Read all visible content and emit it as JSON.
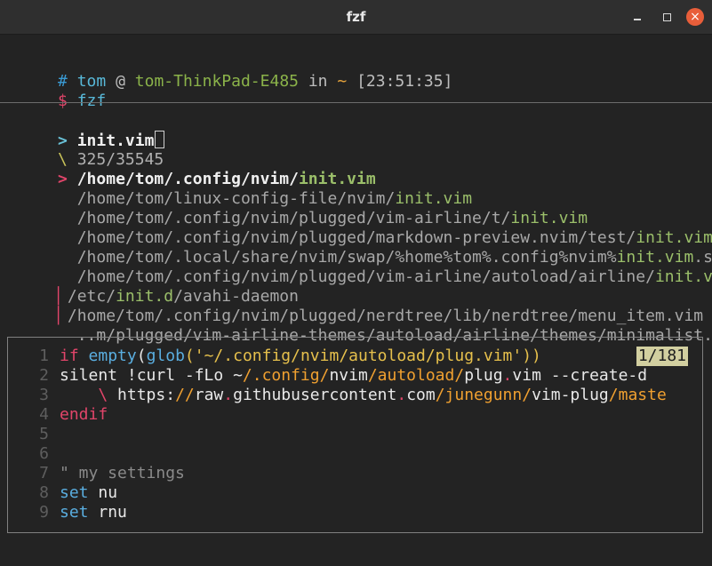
{
  "window": {
    "title": "fzf"
  },
  "prompt": {
    "hash": "#",
    "user": "tom",
    "at": "@",
    "host": "tom-ThinkPad-E485",
    "in": "in",
    "dir": "~",
    "time": "[23:51:35]",
    "dollar": "$",
    "command": "fzf"
  },
  "fzf": {
    "prompt_char": ">",
    "query": "init.vim",
    "info_char": "\\",
    "count": "325/35545",
    "pointer": ">",
    "results": [
      {
        "pre": "/home/tom/.config/nvim/",
        "match": "init.vim",
        "post": ""
      },
      {
        "pre": "/home/tom/linux-config-file/nvim/",
        "match": "init.vim",
        "post": ""
      },
      {
        "pre": "/home/tom/.config/nvim/plugged/vim-airline/t/",
        "match": "init.vim",
        "post": ""
      },
      {
        "pre": "/home/tom/.config/nvim/plugged/markdown-preview.nvim/test/",
        "match": "init.vim",
        "post": ""
      },
      {
        "pre": "/home/tom/.local/share/nvim/swap/%home%tom%.config%nvim%",
        "match": "init.vim",
        "post": ".swp"
      },
      {
        "pre": "/home/tom/.config/nvim/plugged/vim-airline/autoload/airline/",
        "match": "init.vim",
        "post": ""
      },
      {
        "pre": "/etc/",
        "match": "init.d",
        "post": "/avahi-daemon"
      },
      {
        "pre": "/home/tom/.config/nvim/plugged/nerdtree/lib/nerdtree/menu_item.vim",
        "match": "",
        "post": ""
      },
      {
        "pre": "..m/plugged/vim-airline-themes/autoload/airline/themes/minimalist.vim",
        "match": "",
        "post": ""
      }
    ]
  },
  "preview": {
    "position": "1/181",
    "lines": [
      {
        "n": "1"
      },
      {
        "n": "2"
      },
      {
        "n": "3"
      },
      {
        "n": "4"
      },
      {
        "n": "5"
      },
      {
        "n": "6"
      },
      {
        "n": "7"
      },
      {
        "n": "8"
      },
      {
        "n": "9"
      }
    ],
    "code": {
      "l1_if": "if",
      "l1_empty": "empty",
      "l1_open": "(",
      "l1_glob": "glob",
      "l1_str": "('~/.config/nvim/autoload/plug.vim'))",
      "l2_a": "silent !curl -fLo ~",
      "l2_b": "/.config/",
      "l2_c": "nvim",
      "l2_d": "/autoload/",
      "l2_e": "plug",
      "l2_f": ".",
      "l2_g": "vim --create-d",
      "l3_a": "\\",
      "l3_b": " https:",
      "l3_c": "//",
      "l3_d": "raw",
      "l3_e": ".",
      "l3_f": "githubusercontent",
      "l3_g": ".",
      "l3_h": "com",
      "l3_i": "/junegunn/",
      "l3_j": "vim-plug",
      "l3_k": "/maste",
      "l4": "endif",
      "l7": "\" my settings",
      "l8_kw": "set",
      "l8_val": " nu",
      "l9_kw": "set",
      "l9_val": " rnu"
    }
  }
}
